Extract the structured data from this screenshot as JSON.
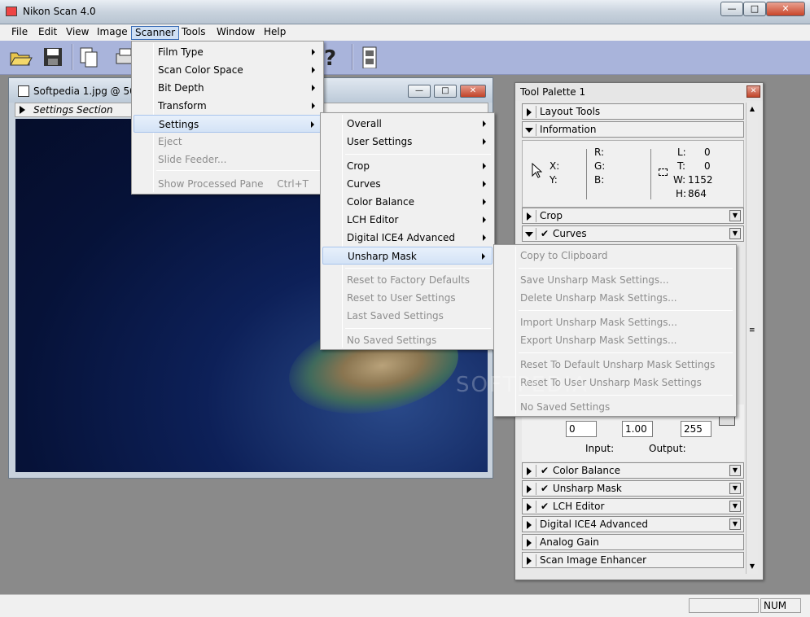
{
  "app": {
    "title": "Nikon Scan 4.0"
  },
  "menubar": [
    "File",
    "Edit",
    "View",
    "Image",
    "Scanner",
    "Tools",
    "Window",
    "Help"
  ],
  "image_window": {
    "title": "Softpedia 1.jpg @ 50%",
    "section": "Settings Section",
    "watermark": "SOFTPEDIA"
  },
  "scanner_menu": [
    {
      "label": "Film Type",
      "submenu": true,
      "enabled": true
    },
    {
      "label": "Scan Color Space",
      "submenu": true,
      "enabled": true
    },
    {
      "label": "Bit Depth",
      "submenu": true,
      "enabled": true
    },
    {
      "label": "Transform",
      "submenu": true,
      "enabled": true
    },
    {
      "label": "Settings",
      "submenu": true,
      "enabled": true,
      "highlighted": true
    },
    {
      "label": "Eject",
      "enabled": false
    },
    {
      "label": "Slide Feeder...",
      "enabled": false
    },
    {
      "label": "Show Processed Pane",
      "shortcut": "Ctrl+T",
      "enabled": false
    }
  ],
  "settings_menu": [
    {
      "label": "Overall",
      "submenu": true
    },
    {
      "label": "User Settings",
      "submenu": true
    },
    {
      "label": "Crop",
      "submenu": true
    },
    {
      "label": "Curves",
      "submenu": true
    },
    {
      "label": "Color Balance",
      "submenu": true
    },
    {
      "label": "LCH Editor",
      "submenu": true
    },
    {
      "label": "Digital ICE4 Advanced",
      "submenu": true
    },
    {
      "label": "Unsharp Mask",
      "submenu": true,
      "highlighted": true
    },
    {
      "label": "Reset to Factory Defaults",
      "enabled": false
    },
    {
      "label": "Reset to User Settings",
      "enabled": false
    },
    {
      "label": "Last Saved Settings",
      "enabled": false
    },
    {
      "label": "No Saved Settings",
      "enabled": false
    }
  ],
  "unsharp_menu": [
    "Copy to Clipboard",
    "Save Unsharp Mask Settings...",
    "Delete Unsharp Mask Settings...",
    "Import Unsharp Mask Settings...",
    "Export Unsharp Mask Settings...",
    "Reset To Default Unsharp Mask Settings",
    "Reset To User Unsharp Mask Settings",
    "No Saved Settings"
  ],
  "palette": {
    "title": "Tool Palette 1",
    "rows": {
      "layout_tools": "Layout Tools",
      "information": "Information",
      "crop": "Crop",
      "curves": "Curves",
      "color_balance": "Color Balance",
      "unsharp_mask": "Unsharp Mask",
      "lch_editor": "LCH Editor",
      "digital_ice": "Digital ICE4 Advanced",
      "analog_gain": "Analog Gain",
      "scan_image_enhancer": "Scan Image Enhancer"
    },
    "info": {
      "x_label": "X:",
      "y_label": "Y:",
      "r_label": "R:",
      "g_label": "G:",
      "b_label": "B:",
      "l_label": "L:",
      "l_value": "0",
      "t_label": "T:",
      "t_value": "0",
      "w_label": "W:",
      "w_value": "1152",
      "h_label": "H:",
      "h_value": "864"
    },
    "curves": {
      "input_low": "0",
      "gamma": "1.00",
      "output_high": "255",
      "input_label": "Input:",
      "output_label": "Output:"
    }
  },
  "statusbar": {
    "num": "NUM"
  },
  "check_glyph": "✔"
}
